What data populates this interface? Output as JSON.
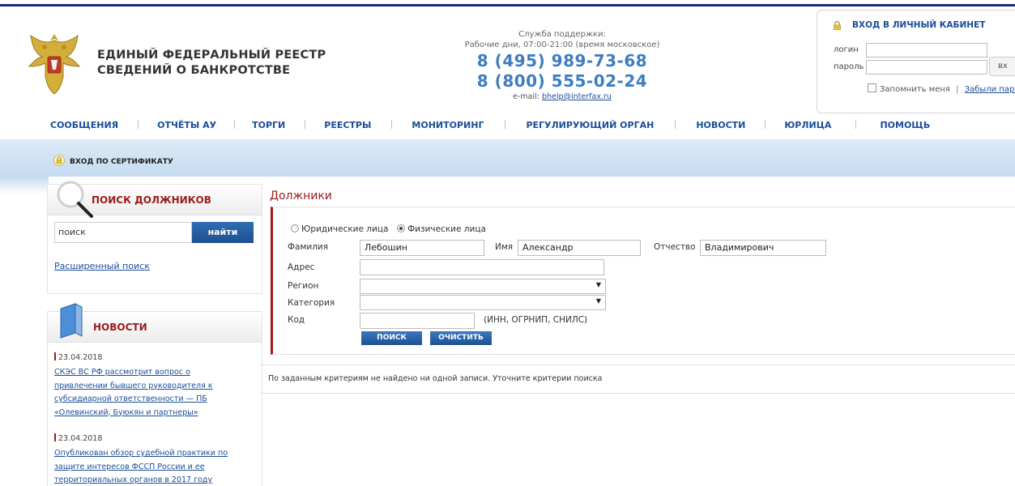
{
  "header": {
    "title_line1": "ЕДИНЫЙ ФЕДЕРАЛЬНЫЙ РЕЕСТР",
    "title_line2": "СВЕДЕНИЙ О БАНКРОТСТВЕ",
    "crest_icon": "russian-coat-of-arms-icon"
  },
  "support": {
    "title": "Служба поддержки:",
    "hours": "Рабочие дни, 07:00-21:00 (время московское)",
    "phone1": "8 (495) 989-73-68",
    "phone2": "8 (800) 555-02-24",
    "email_label": "e-mail:",
    "email": "bhelp@interfax.ru"
  },
  "login": {
    "title": "ВХОД В ЛИЧНЫЙ КАБИНЕТ",
    "login_label": "логин",
    "password_label": "пароль",
    "enter_label": "вх",
    "remember_label": "Запомнить меня",
    "forgot_label": "Забыли паро"
  },
  "menu": {
    "items": [
      {
        "label": "СООБЩЕНИЯ"
      },
      {
        "label": "ОТЧЁТЫ АУ"
      },
      {
        "label": "ТОРГИ"
      },
      {
        "label": "РЕЕСТРЫ"
      },
      {
        "label": "МОНИТОРИНГ"
      },
      {
        "label": "РЕГУЛИРУЮЩИЙ ОРГАН"
      },
      {
        "label": "НОВОСТИ"
      },
      {
        "label": "ЮРЛИЦА"
      },
      {
        "label": "ПОМОЩЬ"
      }
    ]
  },
  "cert": {
    "label": "ВХОД ПО СЕРТИФИКАТУ"
  },
  "sidebar": {
    "search_title": "ПОИСК ДОЛЖНИКОВ",
    "search_value": "поиск",
    "search_button": "найти",
    "advanced_link": "Расширенный поиск",
    "news_title": "НОВОСТИ",
    "news": [
      {
        "date": "23.04.2018",
        "lines": [
          "СКЭС ВС РФ рассмотрит вопрос о",
          "привлечении бывшего руководителя к",
          "субсидиарной ответственности — ПБ",
          "«Олевинский, Буюкян и партнеры»"
        ]
      },
      {
        "date": "23.04.2018",
        "lines": [
          "Опубликован обзор судебной практики по",
          "защите интересов ФССП России и ее",
          "территориальных органов в 2017 году"
        ]
      }
    ]
  },
  "main": {
    "title": "Должники",
    "radio_legal": "Юридические лица",
    "radio_physical": "Физические лица",
    "selected_type": "Физические лица",
    "lastname_label": "Фамилия",
    "lastname_value": "Лебошин",
    "firstname_label": "Имя",
    "firstname_value": "Александр",
    "middlename_label": "Отчество",
    "middlename_value": "Владимирович",
    "address_label": "Адрес",
    "address_value": "",
    "region_label": "Регион",
    "region_value": "",
    "category_label": "Категория",
    "category_value": "",
    "code_label": "Код",
    "code_value": "",
    "code_hint": "(ИНН, ОГРНИП, СНИЛС)",
    "search_button": "ПОИСК",
    "clear_button": "ОЧИСТИТЬ",
    "result_text": "По заданным критериям не найдено ни одной записи. Уточните критерии поиска"
  },
  "colors": {
    "brand_blue": "#1a4d99",
    "accent_red": "#9c1a1a",
    "phone_blue": "#3f7dbf",
    "bar_blue": "#c5dcef"
  }
}
